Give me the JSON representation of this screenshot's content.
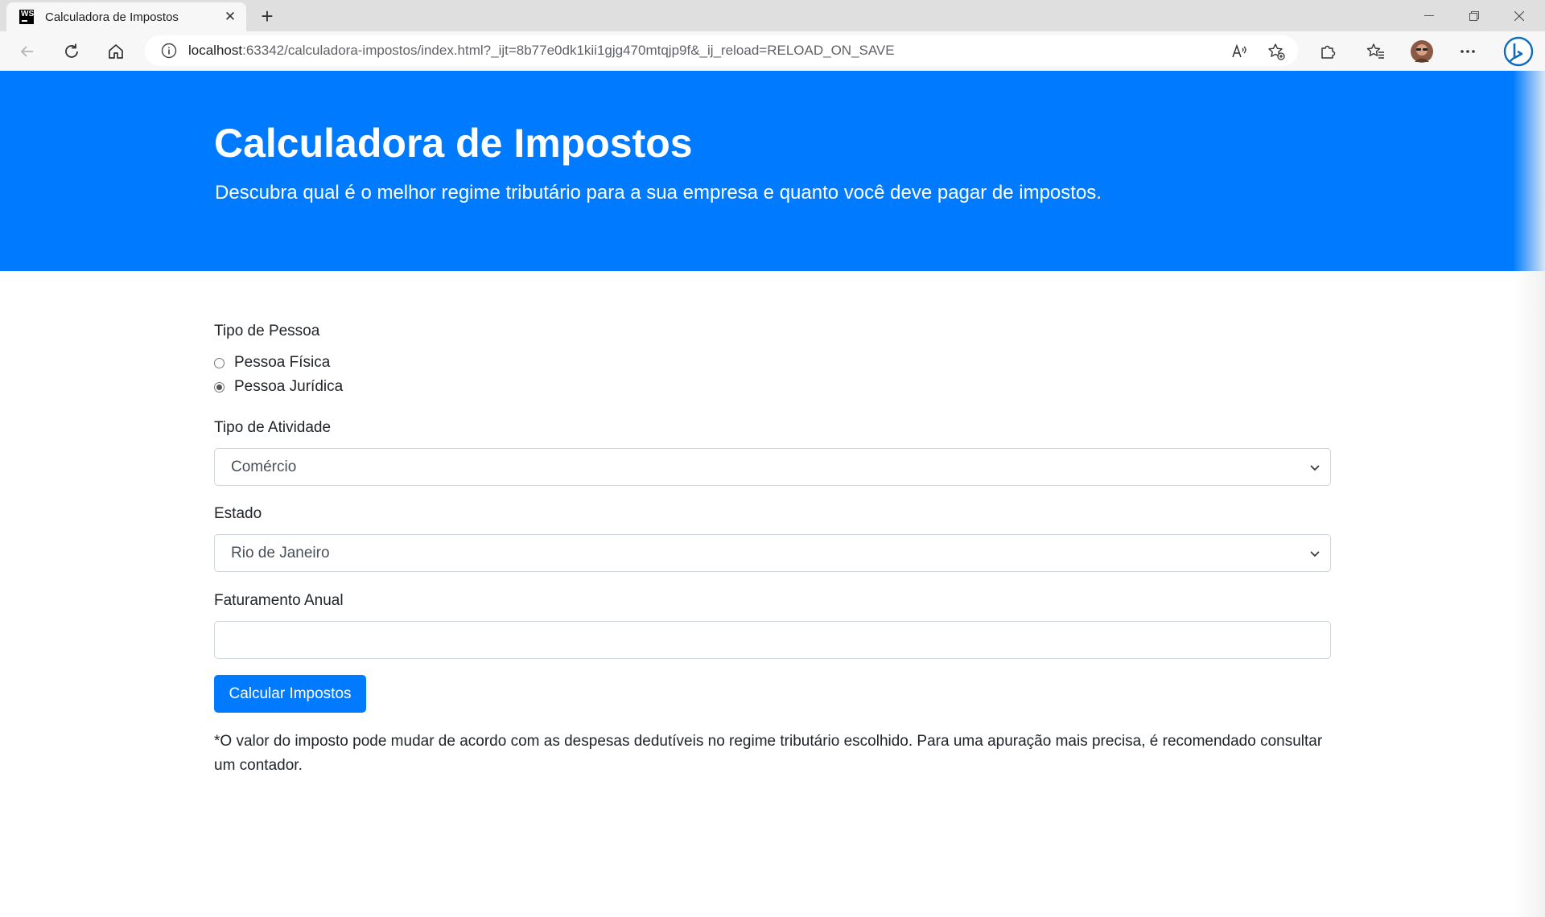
{
  "browser": {
    "tab_title": "Calculadora de Impostos",
    "favicon_text": "WS",
    "url_host": "localhost",
    "url_rest": ":63342/calculadora-impostos/index.html?_ijt=8b77e0dk1kii1gjg470mtqjp9f&_ij_reload=RELOAD_ON_SAVE",
    "accent_color": "#0f6cbd"
  },
  "hero": {
    "title": "Calculadora de Impostos",
    "subtitle": "Descubra qual é o melhor regime tributário para a sua empresa e quanto você deve pagar de impostos.",
    "background": "#007bff"
  },
  "form": {
    "tipo_pessoa_label": "Tipo de Pessoa",
    "options_pessoa": [
      {
        "label": "Pessoa Física",
        "checked": false
      },
      {
        "label": "Pessoa Jurídica",
        "checked": true
      }
    ],
    "atividade_label": "Tipo de Atividade",
    "atividade_value": "Comércio",
    "estado_label": "Estado",
    "estado_value": "Rio de Janeiro",
    "faturamento_label": "Faturamento Anual",
    "faturamento_value": "",
    "submit_label": "Calcular Impostos"
  },
  "note": "*O valor do imposto pode mudar de acordo com as despesas dedutíveis no regime tributário escolhido. Para uma apuração mais precisa, é recomendado consultar um contador."
}
